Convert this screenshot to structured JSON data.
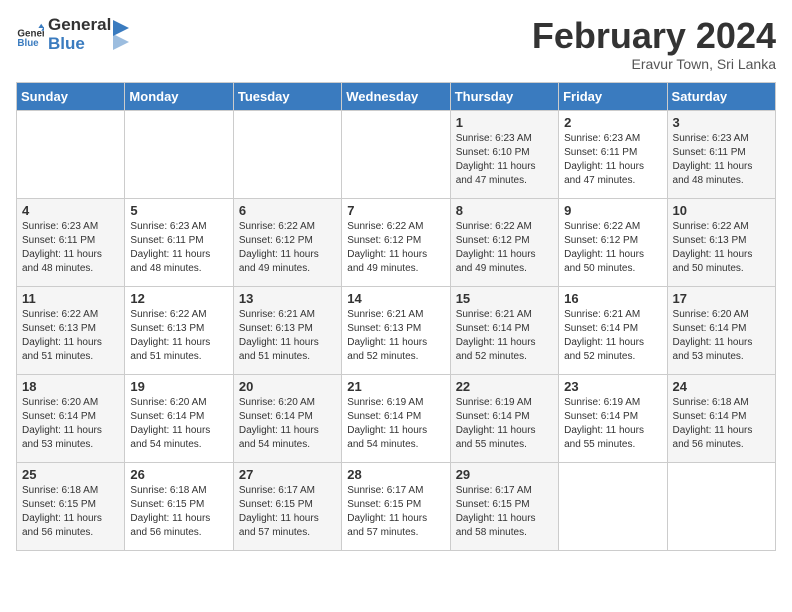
{
  "logo": {
    "general": "General",
    "blue": "Blue"
  },
  "title": "February 2024",
  "subtitle": "Eravur Town, Sri Lanka",
  "days_of_week": [
    "Sunday",
    "Monday",
    "Tuesday",
    "Wednesday",
    "Thursday",
    "Friday",
    "Saturday"
  ],
  "weeks": [
    [
      {
        "day": "",
        "sunrise": "",
        "sunset": "",
        "daylight": ""
      },
      {
        "day": "",
        "sunrise": "",
        "sunset": "",
        "daylight": ""
      },
      {
        "day": "",
        "sunrise": "",
        "sunset": "",
        "daylight": ""
      },
      {
        "day": "",
        "sunrise": "",
        "sunset": "",
        "daylight": ""
      },
      {
        "day": "1",
        "sunrise": "Sunrise: 6:23 AM",
        "sunset": "Sunset: 6:10 PM",
        "daylight": "Daylight: 11 hours and 47 minutes."
      },
      {
        "day": "2",
        "sunrise": "Sunrise: 6:23 AM",
        "sunset": "Sunset: 6:11 PM",
        "daylight": "Daylight: 11 hours and 47 minutes."
      },
      {
        "day": "3",
        "sunrise": "Sunrise: 6:23 AM",
        "sunset": "Sunset: 6:11 PM",
        "daylight": "Daylight: 11 hours and 48 minutes."
      }
    ],
    [
      {
        "day": "4",
        "sunrise": "Sunrise: 6:23 AM",
        "sunset": "Sunset: 6:11 PM",
        "daylight": "Daylight: 11 hours and 48 minutes."
      },
      {
        "day": "5",
        "sunrise": "Sunrise: 6:23 AM",
        "sunset": "Sunset: 6:11 PM",
        "daylight": "Daylight: 11 hours and 48 minutes."
      },
      {
        "day": "6",
        "sunrise": "Sunrise: 6:22 AM",
        "sunset": "Sunset: 6:12 PM",
        "daylight": "Daylight: 11 hours and 49 minutes."
      },
      {
        "day": "7",
        "sunrise": "Sunrise: 6:22 AM",
        "sunset": "Sunset: 6:12 PM",
        "daylight": "Daylight: 11 hours and 49 minutes."
      },
      {
        "day": "8",
        "sunrise": "Sunrise: 6:22 AM",
        "sunset": "Sunset: 6:12 PM",
        "daylight": "Daylight: 11 hours and 49 minutes."
      },
      {
        "day": "9",
        "sunrise": "Sunrise: 6:22 AM",
        "sunset": "Sunset: 6:12 PM",
        "daylight": "Daylight: 11 hours and 50 minutes."
      },
      {
        "day": "10",
        "sunrise": "Sunrise: 6:22 AM",
        "sunset": "Sunset: 6:13 PM",
        "daylight": "Daylight: 11 hours and 50 minutes."
      }
    ],
    [
      {
        "day": "11",
        "sunrise": "Sunrise: 6:22 AM",
        "sunset": "Sunset: 6:13 PM",
        "daylight": "Daylight: 11 hours and 51 minutes."
      },
      {
        "day": "12",
        "sunrise": "Sunrise: 6:22 AM",
        "sunset": "Sunset: 6:13 PM",
        "daylight": "Daylight: 11 hours and 51 minutes."
      },
      {
        "day": "13",
        "sunrise": "Sunrise: 6:21 AM",
        "sunset": "Sunset: 6:13 PM",
        "daylight": "Daylight: 11 hours and 51 minutes."
      },
      {
        "day": "14",
        "sunrise": "Sunrise: 6:21 AM",
        "sunset": "Sunset: 6:13 PM",
        "daylight": "Daylight: 11 hours and 52 minutes."
      },
      {
        "day": "15",
        "sunrise": "Sunrise: 6:21 AM",
        "sunset": "Sunset: 6:14 PM",
        "daylight": "Daylight: 11 hours and 52 minutes."
      },
      {
        "day": "16",
        "sunrise": "Sunrise: 6:21 AM",
        "sunset": "Sunset: 6:14 PM",
        "daylight": "Daylight: 11 hours and 52 minutes."
      },
      {
        "day": "17",
        "sunrise": "Sunrise: 6:20 AM",
        "sunset": "Sunset: 6:14 PM",
        "daylight": "Daylight: 11 hours and 53 minutes."
      }
    ],
    [
      {
        "day": "18",
        "sunrise": "Sunrise: 6:20 AM",
        "sunset": "Sunset: 6:14 PM",
        "daylight": "Daylight: 11 hours and 53 minutes."
      },
      {
        "day": "19",
        "sunrise": "Sunrise: 6:20 AM",
        "sunset": "Sunset: 6:14 PM",
        "daylight": "Daylight: 11 hours and 54 minutes."
      },
      {
        "day": "20",
        "sunrise": "Sunrise: 6:20 AM",
        "sunset": "Sunset: 6:14 PM",
        "daylight": "Daylight: 11 hours and 54 minutes."
      },
      {
        "day": "21",
        "sunrise": "Sunrise: 6:19 AM",
        "sunset": "Sunset: 6:14 PM",
        "daylight": "Daylight: 11 hours and 54 minutes."
      },
      {
        "day": "22",
        "sunrise": "Sunrise: 6:19 AM",
        "sunset": "Sunset: 6:14 PM",
        "daylight": "Daylight: 11 hours and 55 minutes."
      },
      {
        "day": "23",
        "sunrise": "Sunrise: 6:19 AM",
        "sunset": "Sunset: 6:14 PM",
        "daylight": "Daylight: 11 hours and 55 minutes."
      },
      {
        "day": "24",
        "sunrise": "Sunrise: 6:18 AM",
        "sunset": "Sunset: 6:14 PM",
        "daylight": "Daylight: 11 hours and 56 minutes."
      }
    ],
    [
      {
        "day": "25",
        "sunrise": "Sunrise: 6:18 AM",
        "sunset": "Sunset: 6:15 PM",
        "daylight": "Daylight: 11 hours and 56 minutes."
      },
      {
        "day": "26",
        "sunrise": "Sunrise: 6:18 AM",
        "sunset": "Sunset: 6:15 PM",
        "daylight": "Daylight: 11 hours and 56 minutes."
      },
      {
        "day": "27",
        "sunrise": "Sunrise: 6:17 AM",
        "sunset": "Sunset: 6:15 PM",
        "daylight": "Daylight: 11 hours and 57 minutes."
      },
      {
        "day": "28",
        "sunrise": "Sunrise: 6:17 AM",
        "sunset": "Sunset: 6:15 PM",
        "daylight": "Daylight: 11 hours and 57 minutes."
      },
      {
        "day": "29",
        "sunrise": "Sunrise: 6:17 AM",
        "sunset": "Sunset: 6:15 PM",
        "daylight": "Daylight: 11 hours and 58 minutes."
      },
      {
        "day": "",
        "sunrise": "",
        "sunset": "",
        "daylight": ""
      },
      {
        "day": "",
        "sunrise": "",
        "sunset": "",
        "daylight": ""
      }
    ]
  ]
}
